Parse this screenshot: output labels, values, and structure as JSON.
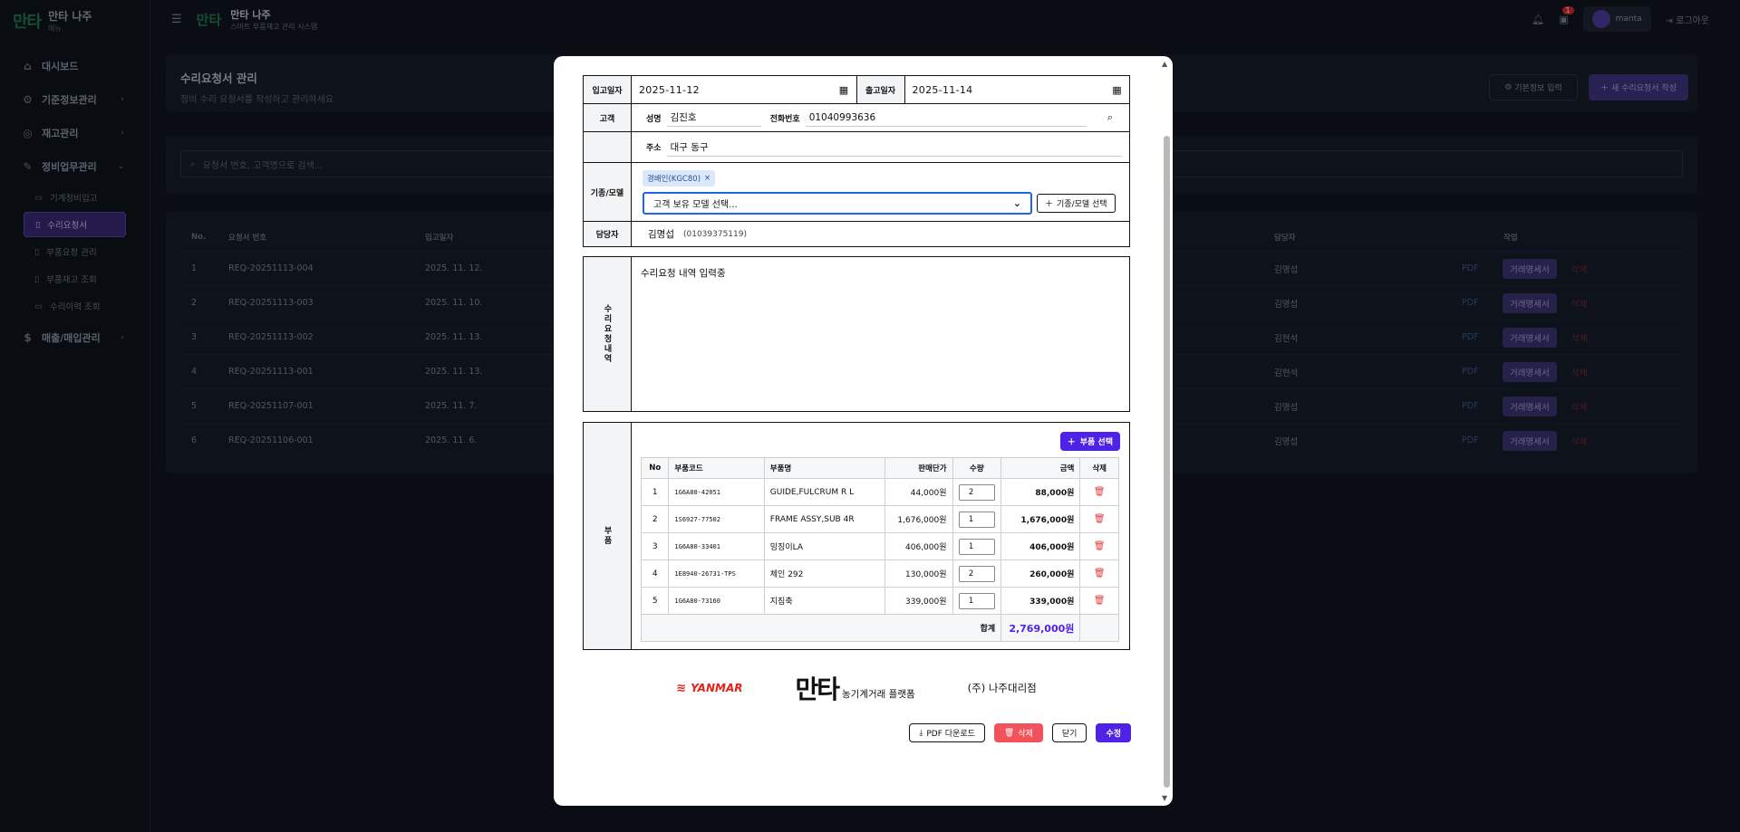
{
  "app": {
    "brand_title": "만타 나주",
    "brand_sub": "메뉴",
    "top_title": "만타 나주",
    "top_sub": "스마트 부품재고 관리 시스템",
    "notif_count": "1",
    "user_name": "manta",
    "logout": "로그아웃"
  },
  "sidebar": {
    "dashboard": "대시보드",
    "base_info": "기준정보관리",
    "inventory": "재고관리",
    "maintenance": "정비업무관리",
    "subs": [
      "기계정비입고",
      "수리요청서",
      "부품요청 관리",
      "부품재고 조회",
      "수리이력 조회"
    ],
    "sales": "매출/매입관리"
  },
  "page": {
    "title": "수리요청서 관리",
    "desc": "정비 수리 요청서를 작성하고 관리하세요",
    "btn_base": "기본정보 입력",
    "btn_new": "새 수리요청서 작성",
    "search_placeholder": "요청서 번호, 고객명으로 검색...",
    "table_headers": [
      "No.",
      "요청서 번호",
      "입고일자",
      "담당자",
      "작업"
    ],
    "rows": [
      {
        "no": "1",
        "id": "REQ-20251113-004",
        "date": "2025. 11. 12.",
        "staff": "김명섭"
      },
      {
        "no": "2",
        "id": "REQ-20251113-003",
        "date": "2025. 11. 10.",
        "staff": "김명섭"
      },
      {
        "no": "3",
        "id": "REQ-20251113-002",
        "date": "2025. 11. 13.",
        "staff": "김현석"
      },
      {
        "no": "4",
        "id": "REQ-20251113-001",
        "date": "2025. 11. 13.",
        "staff": "김현석"
      },
      {
        "no": "5",
        "id": "REQ-20251107-001",
        "date": "2025. 11. 7.",
        "staff": "김명섭"
      },
      {
        "no": "6",
        "id": "REQ-20251106-001",
        "date": "2025. 11. 6.",
        "staff": "김명섭"
      }
    ],
    "row_pdf": "PDF",
    "row_statement": "거래명세서",
    "row_delete": "삭제"
  },
  "modal": {
    "in_date_label": "입고일자",
    "in_date": "2025-11-12",
    "out_date_label": "출고일자",
    "out_date": "2025-11-14",
    "customer_label": "고객",
    "name_label": "성명",
    "name": "김진호",
    "phone_label": "전화번호",
    "phone": "01040993636",
    "address_label": "주소",
    "address": "대구 동구",
    "model_label": "기종/모델",
    "model_chip": "경배인(KGC80)",
    "model_select": "고객 보유 모델 선택...",
    "model_btn": "기종/모델 선택",
    "staff_label": "담당자",
    "staff": "김명섭",
    "staff_phone": "(01039375119)",
    "request_label": "수리요청내역",
    "request_text": "수리요청 내역 입력중",
    "parts_label": "부품",
    "parts_btn": "부품 선택",
    "parts_headers": [
      "No",
      "부품코드",
      "부품명",
      "판매단가",
      "수량",
      "금액",
      "삭제"
    ],
    "parts": [
      {
        "no": "1",
        "code": "1G6A80-42051",
        "name": "GUIDE,FULCRUM R L",
        "price": "44,000원",
        "qty": "2",
        "amount": "88,000원"
      },
      {
        "no": "2",
        "code": "1S6927-77502",
        "name": "FRAME ASSY,SUB 4R",
        "price": "1,676,000원",
        "qty": "1",
        "amount": "1,676,000원"
      },
      {
        "no": "3",
        "code": "1G6A80-33401",
        "name": "밍징이LA",
        "price": "406,000원",
        "qty": "1",
        "amount": "406,000원"
      },
      {
        "no": "4",
        "code": "1E8940-26731-TPS",
        "name": "체인 292",
        "price": "130,000원",
        "qty": "2",
        "amount": "260,000원"
      },
      {
        "no": "5",
        "code": "1G6A80-73160",
        "name": "지짐축",
        "price": "339,000원",
        "qty": "1",
        "amount": "339,000원"
      }
    ],
    "total_label": "합계",
    "total": "2,769,000원",
    "logo_yanmar": "YANMAR",
    "logo_manta_sub": "농기계거래 플랫폼",
    "logo_dealer": "(주) 나주대리점",
    "btn_pdf": "PDF 다운로드",
    "btn_delete": "삭제",
    "btn_close": "닫기",
    "btn_edit": "수정"
  }
}
